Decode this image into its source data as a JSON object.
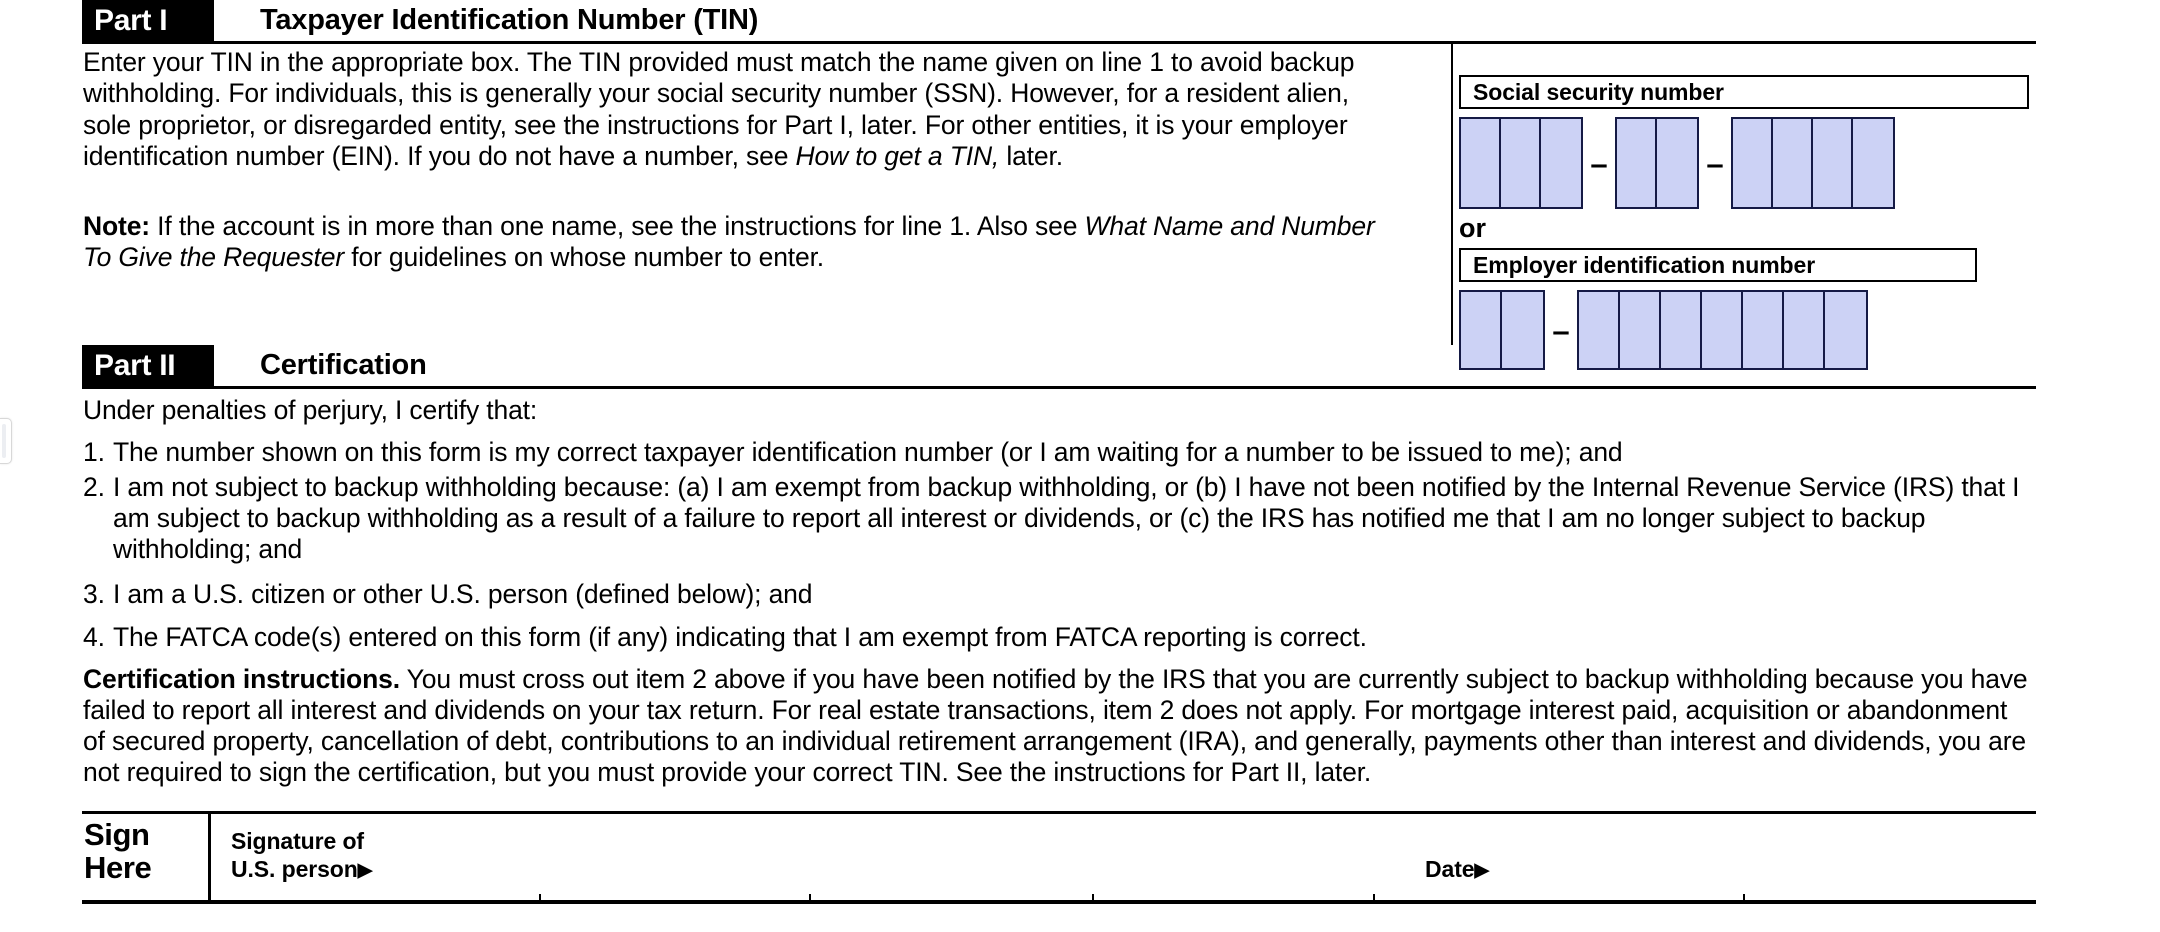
{
  "form": {
    "part1": {
      "tag": "Part I",
      "title": "Taxpayer Identification Number (TIN)",
      "intro_html": "Enter your TIN in the appropriate box. The TIN provided must match the name given on line 1 to avoid backup withholding. For individuals, this is generally your social security number (SSN). However, for a resident alien, sole proprietor, or disregarded entity, see the instructions for Part I, later. For other entities, it is your employer identification number (EIN). If you do not have a number, see <i>How to get a TIN,</i> later.",
      "note_label": "Note:",
      "note_html": "<b>Note:</b> If the account is in more than one name, see the instructions for line 1. Also see <i>What Name and Number To Give the Requester</i> for guidelines on whose number to enter.",
      "ssn_label": "Social security number",
      "or_label": "or",
      "ein_label": "Employer identification number",
      "ssn_groups": [
        3,
        2,
        4
      ],
      "ein_groups": [
        2,
        7
      ],
      "separator": "–"
    },
    "part2": {
      "tag": "Part II",
      "title": "Certification",
      "lead": "Under penalties of perjury, I certify that:",
      "items": [
        {
          "number": "1.",
          "text": "The number shown on this form is my correct taxpayer identification number (or I am waiting for a number to be issued to me); and"
        },
        {
          "number": "2.",
          "text": "I am not subject to backup withholding because: (a) I am exempt from backup withholding, or (b) I have not been notified by the Internal Revenue Service (IRS) that I am subject to backup withholding as a result of a failure to report all interest or dividends, or (c) the IRS has notified me that I am no longer subject to backup withholding; and"
        },
        {
          "number": "3.",
          "text": "I am a U.S. citizen or other U.S. person (defined below); and"
        },
        {
          "number": "4.",
          "text": "The FATCA code(s) entered on this form (if any) indicating that I am exempt from FATCA reporting is correct."
        }
      ],
      "instructions_label": "Certification instructions.",
      "instructions_html": "<b>Certification instructions.</b> You must cross out item 2 above if you have been notified by the IRS that you are currently subject to backup withholding because you have failed to report all interest and dividends on your tax return. For real estate transactions, item 2 does not apply. For mortgage interest paid, acquisition or abandonment of secured property, cancellation of debt, contributions to an individual retirement arrangement (IRA), and generally, payments other than interest and dividends, you are not required to sign the certification, but you must provide your correct TIN. See the instructions for Part II, later."
    },
    "signature": {
      "sign_here_line1": "Sign",
      "sign_here_line2": "Here",
      "signature_line1": "Signature of",
      "signature_line2": "U.S. person",
      "signature_arrow": "▶",
      "date_label": "Date",
      "date_arrow": "▶",
      "signature_value": "",
      "date_value": ""
    }
  },
  "colors": {
    "box_fill": "#ccd2f5",
    "box_border": "#151a45",
    "rule": "#000000",
    "page_background": "#ffffff",
    "tag_background": "#000000",
    "tag_text": "#ffffff"
  }
}
